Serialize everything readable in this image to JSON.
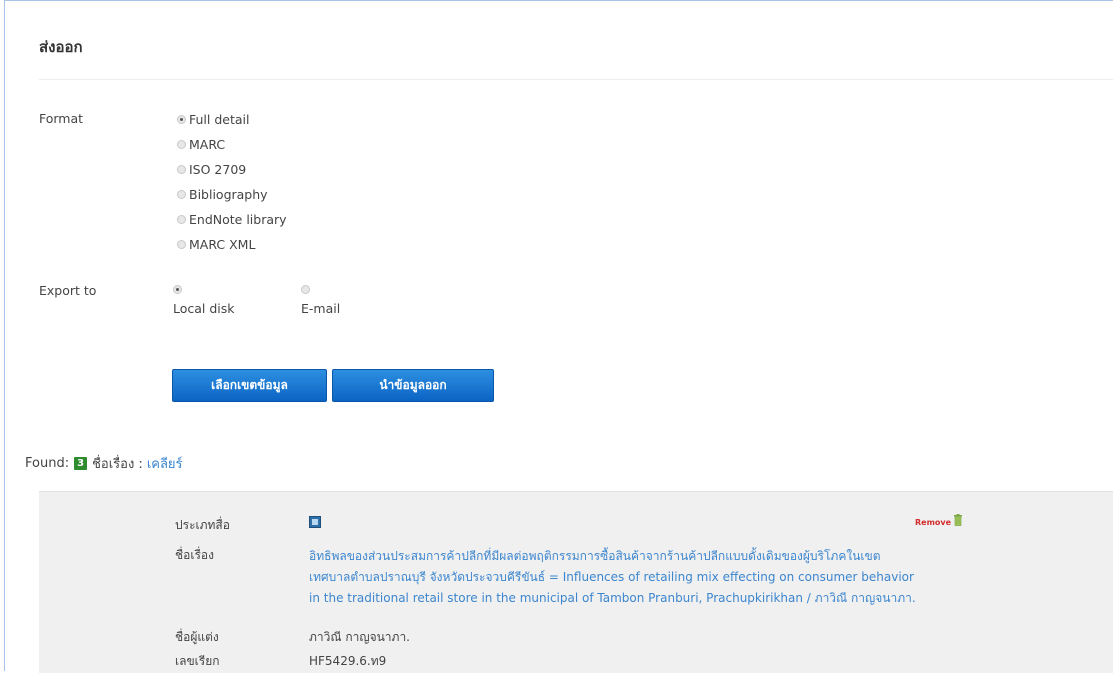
{
  "page": {
    "title": "ส่งออก"
  },
  "format": {
    "label": "Format",
    "options": [
      "Full detail",
      "MARC",
      "ISO 2709",
      "Bibliography",
      "EndNote library",
      "MARC XML"
    ],
    "selected": "Full detail"
  },
  "export": {
    "label": "Export to",
    "options": [
      "Local disk",
      "E-mail"
    ],
    "selected": "Local disk"
  },
  "buttons": {
    "select_range": "เลือกเขตข้อมูล",
    "export_data": "นำข้อมูลออก"
  },
  "found": {
    "label": "Found:",
    "count": "3",
    "suffix": "ชื่อเรื่อง :",
    "clear": "เคลียร์"
  },
  "record": {
    "type_label": "ประเภทสื่อ",
    "title_label": "ชื่อเรื่อง",
    "title_line1": "อิทธิพลของส่วนประสมการค้าปลีกที่มีผลต่อพฤติกรรมการซื้อสินค้าจากร้านค้าปลีกแบบดั้งเดิมของผู้บริโภคในเขต",
    "title_line2": "เทศบาลตำบลปราณบุรี จังหวัดประจวบคีรีขันธ์ = Influences of retailing mix effecting on consumer behavior",
    "title_line3": "in the traditional retail store in the municipal of Tambon Pranburi, Prachupkirikhan / ภาวิณี กาญจนาภา.",
    "author_label": "ชื่อผู้แต่ง",
    "author": "ภาวิณี กาญจนาภา.",
    "callno_label": "เลขเรียก",
    "callno": "HF5429.6.ท9",
    "remove": "Remove",
    "type_icon": "book-icon",
    "remove_icon": "trash-icon"
  },
  "colors": {
    "button": "#0b64c4",
    "link": "#3c86cf",
    "badge": "#2e8b2e",
    "remove": "#d42b2b",
    "panel": "#f0f0f0"
  }
}
